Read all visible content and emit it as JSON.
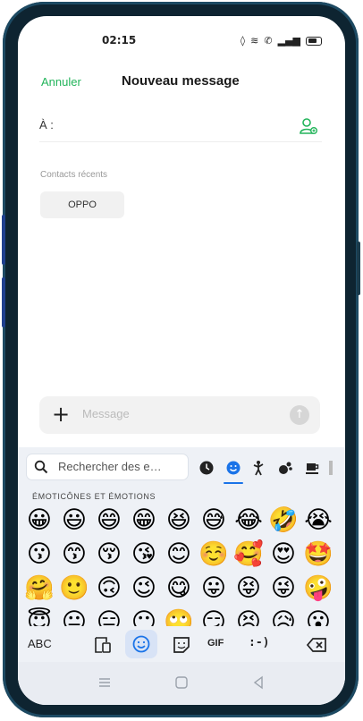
{
  "status_bar": {
    "time": "02:15"
  },
  "header": {
    "cancel_label": "Annuler",
    "title": "Nouveau message"
  },
  "recipient": {
    "label": "À :"
  },
  "recent": {
    "label": "Contacts récents",
    "contacts": [
      "OPPO"
    ]
  },
  "composer": {
    "placeholder": "Message"
  },
  "keyboard": {
    "search_placeholder": "Rechercher des e…",
    "section_label": "ÉMOTICÔNES ET ÉMOTIONS",
    "emojis": [
      [
        "😀",
        "😃",
        "😄",
        "😁",
        "😆",
        "😅",
        "😂",
        "🤣",
        "😭"
      ],
      [
        "😗",
        "😙",
        "😚",
        "😘",
        "😊",
        "☺️",
        "🥰",
        "😍",
        "🤩"
      ],
      [
        "🤗",
        "🙂",
        "🙃",
        "😉",
        "😋",
        "😛",
        "😝",
        "😜",
        "🤪"
      ],
      [
        "😇",
        "😐",
        "😑",
        "😶",
        "🙄",
        "😏",
        "😣",
        "😥",
        "😮"
      ]
    ],
    "abc_label": "ABC",
    "gif_label": "GIF",
    "emoticon_label": ":-)"
  },
  "colors": {
    "accent_green": "#22b45a",
    "accent_blue": "#1a73e8"
  }
}
